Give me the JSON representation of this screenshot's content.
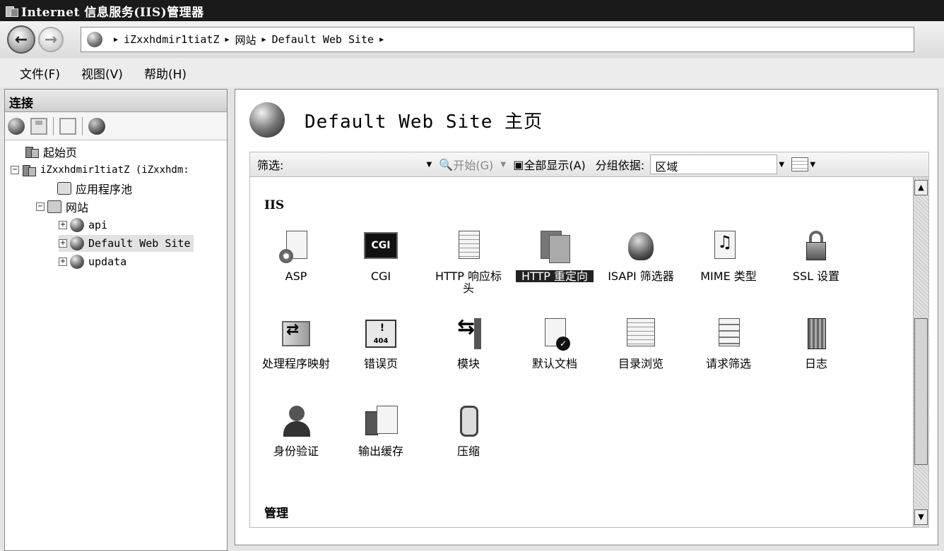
{
  "window": {
    "title": "Internet 信息服务(IIS)管理器"
  },
  "address": {
    "crumbs": [
      "iZxxhdmir1tiatZ",
      "网站",
      "Default Web Site"
    ]
  },
  "menu": [
    "文件(F)",
    "视图(V)",
    "帮助(H)"
  ],
  "connections": {
    "header": "连接",
    "tree": [
      {
        "label": "起始页",
        "icon": "start-page-icon"
      },
      {
        "label": "iZxxhdmir1tiatZ (iZxxhdm:",
        "icon": "server-icon",
        "expander": "−"
      },
      {
        "label": "应用程序池",
        "icon": "app-pool-icon"
      },
      {
        "label": "网站",
        "icon": "sites-folder-icon",
        "expander": "−"
      },
      {
        "label": "api",
        "icon": "site-globe-icon",
        "expander": "+"
      },
      {
        "label": "Default Web Site",
        "icon": "site-globe-icon",
        "expander": "+",
        "selected": true
      },
      {
        "label": "updata",
        "icon": "site-globe-icon",
        "expander": "+"
      }
    ]
  },
  "page": {
    "title": "Default Web Site 主页",
    "filter": {
      "label": "筛选:",
      "start": "开始(G)",
      "show_all": "全部显示(A)",
      "group_by_label": "分组依据:",
      "group_by_value": "区域"
    },
    "sections": [
      {
        "title": "IIS",
        "features": [
          {
            "label": "ASP",
            "icon": "asp-icon"
          },
          {
            "label": "CGI",
            "icon": "cgi-icon"
          },
          {
            "label": "HTTP 响应标头",
            "icon": "http-response-headers-icon"
          },
          {
            "label": "HTTP 重定向",
            "icon": "http-redirect-icon",
            "selected": true
          },
          {
            "label": "ISAPI 筛选器",
            "icon": "isapi-filters-icon"
          },
          {
            "label": "MIME 类型",
            "icon": "mime-types-icon"
          },
          {
            "label": "SSL 设置",
            "icon": "ssl-settings-icon"
          },
          {
            "label": "处理程序映射",
            "icon": "handler-mappings-icon"
          },
          {
            "label": "错误页",
            "icon": "error-pages-icon"
          },
          {
            "label": "模块",
            "icon": "modules-icon"
          },
          {
            "label": "默认文档",
            "icon": "default-document-icon"
          },
          {
            "label": "目录浏览",
            "icon": "directory-browsing-icon"
          },
          {
            "label": "请求筛选",
            "icon": "request-filtering-icon"
          },
          {
            "label": "日志",
            "icon": "logging-icon"
          },
          {
            "label": "身份验证",
            "icon": "authentication-icon"
          },
          {
            "label": "输出缓存",
            "icon": "output-caching-icon"
          },
          {
            "label": "压缩",
            "icon": "compression-icon"
          }
        ]
      },
      {
        "title": "管理"
      }
    ],
    "cgi_badge": "CGI",
    "error_badge": "404"
  }
}
